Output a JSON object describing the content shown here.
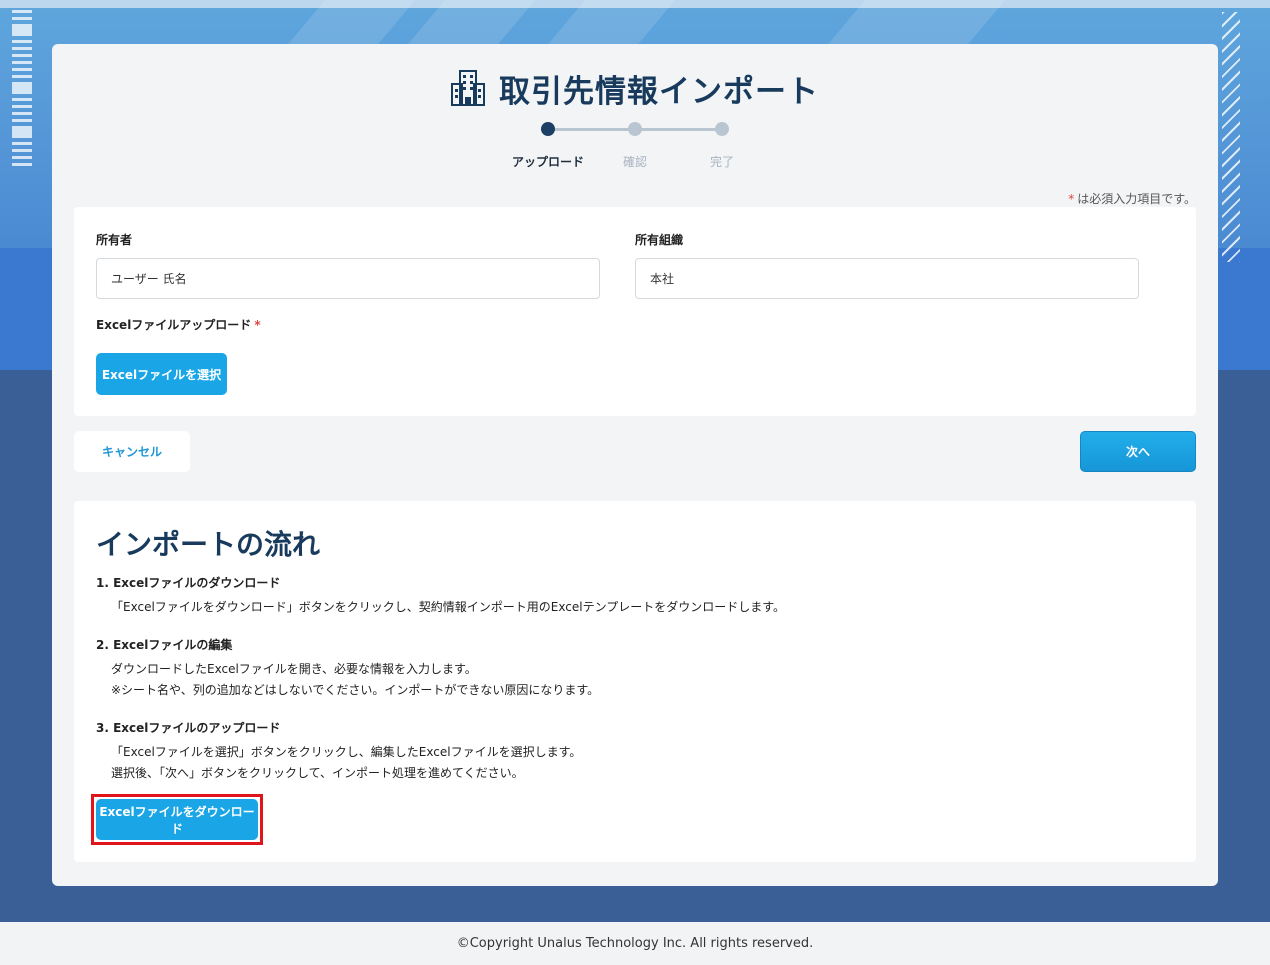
{
  "page": {
    "title": "取引先情報インポート",
    "title_icon": "building-icon"
  },
  "stepper": {
    "steps": [
      {
        "label": "アップロード",
        "active": true
      },
      {
        "label": "確認",
        "active": false
      },
      {
        "label": "完了",
        "active": false
      }
    ]
  },
  "required_note": {
    "asterisk": "*",
    "text": "は必須入力項目です。"
  },
  "form": {
    "owner_label": "所有者",
    "owner_value": "ユーザー 氏名",
    "org_label": "所有組織",
    "org_value": "本社",
    "upload_label": "Excelファイルアップロード",
    "upload_required": "*",
    "select_button": "Excelファイルを選択"
  },
  "actions": {
    "cancel": "キャンセル",
    "next": "次へ"
  },
  "flow": {
    "title": "インポートの流れ",
    "steps": [
      {
        "title": "1. Excelファイルのダウンロード",
        "lines": [
          "「Excelファイルをダウンロード」ボタンをクリックし、契約情報インポート用のExcelテンプレートをダウンロードします。"
        ]
      },
      {
        "title": "2. Excelファイルの編集",
        "lines": [
          "ダウンロードしたExcelファイルを開き、必要な情報を入力します。",
          "※シート名や、列の追加などはしないでください。インポートができない原因になります。"
        ]
      },
      {
        "title": "3. Excelファイルのアップロード",
        "lines": [
          "「Excelファイルを選択」ボタンをクリックし、編集したExcelファイルを選択します。",
          "選択後、「次へ」ボタンをクリックして、インポート処理を進めてください。"
        ]
      }
    ],
    "download_button": "Excelファイルをダウンロード"
  },
  "footer": {
    "copyright": "©Copyright Unalus Technology Inc. All rights reserved."
  },
  "colors": {
    "primary": "#1aa6e6",
    "heading": "#183a5c",
    "required": "#e0463e",
    "highlight": "#e0151b"
  }
}
